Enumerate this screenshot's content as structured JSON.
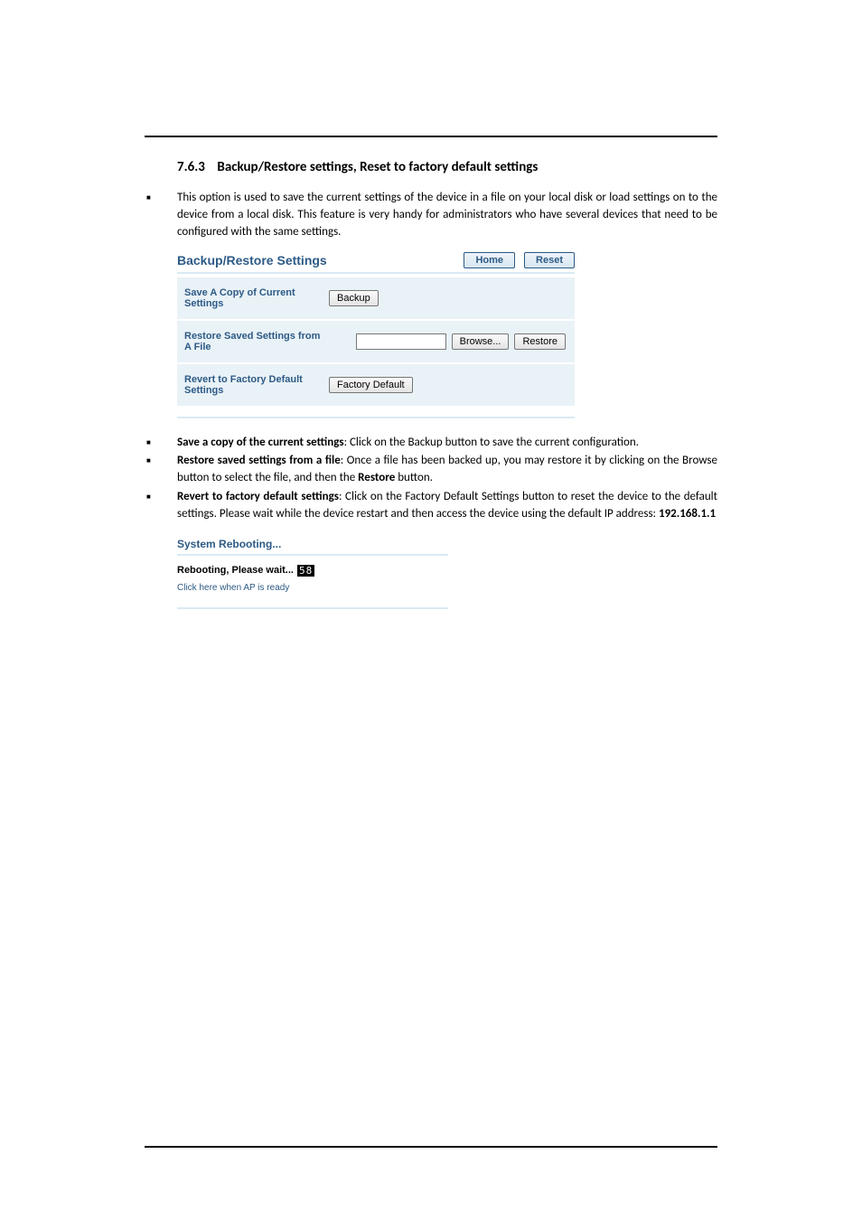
{
  "section": {
    "number": "7.6.3",
    "title": "Backup/Restore settings, Reset to factory default settings"
  },
  "intro_bullet": "This option is used to save the current settings of the device in a file on your local disk or load settings on to the device from a local disk. This feature is very handy for administrators who have several devices that need to be configured with the same settings.",
  "panel": {
    "title": "Backup/Restore Settings",
    "home_btn": "Home",
    "reset_btn": "Reset",
    "rows": {
      "save": {
        "label": "Save A Copy of Current Settings",
        "button": "Backup"
      },
      "restore": {
        "label": "Restore Saved Settings from A File",
        "browse": "Browse...",
        "restore_btn": "Restore"
      },
      "revert": {
        "label": "Revert to Factory Default Settings",
        "button": "Factory Default"
      }
    }
  },
  "bullets": {
    "b1_label": "Save a copy of the current settings",
    "b1_text": ": Click on the Backup button to save the current configuration.",
    "b2_label": "Restore saved settings from a file",
    "b2_text_a": ": Once a file has been backed up, you may restore it by clicking on the Browse button to select the file, and then the ",
    "b2_text_b": "Restore",
    "b2_text_c": " button.",
    "b3_label": "Revert to factory default settings",
    "b3_text_a": ": Click on the Factory Default Settings button to reset the device to the default settings. Please wait while the device restart and then access the device using the default IP address: ",
    "b3_text_b": "192.168.1.1"
  },
  "reboot": {
    "title": "System Rebooting...",
    "line": "Rebooting, Please wait...",
    "counter": "58",
    "link": "Click here when AP is ready"
  }
}
